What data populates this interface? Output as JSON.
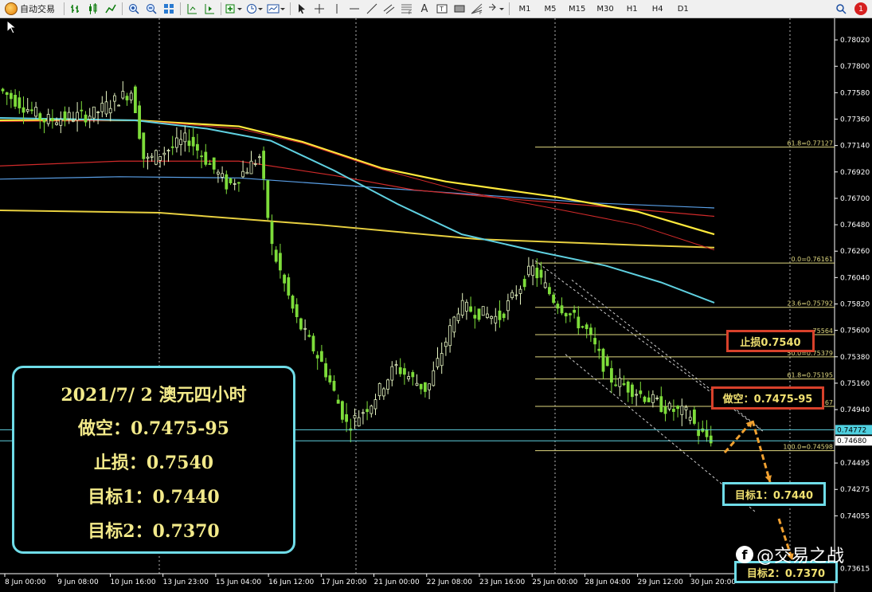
{
  "toolbar": {
    "auto_trade_label": "自动交易",
    "timeframes": [
      "M1",
      "M5",
      "M15",
      "M30",
      "H1",
      "H4",
      "D1"
    ],
    "notification_count": "1"
  },
  "chart_data": {
    "type": "candlestick",
    "symbol_note": "AUDUSD H4",
    "y_ticks": [
      "0.78020",
      "0.77800",
      "0.77580",
      "0.77360",
      "0.77140",
      "0.76920",
      "0.76700",
      "0.76480",
      "0.76260",
      "0.76040",
      "0.75820",
      "0.75600",
      "0.75380",
      "0.75160",
      "0.74940",
      "0.74495",
      "0.74275",
      "0.74055",
      "0.73615"
    ],
    "ylim": [
      0.735,
      0.7812
    ],
    "price_tags": [
      {
        "value": "0.74772",
        "bg": "#4fd0e0"
      },
      {
        "value": "0.74680",
        "bg": "#ffffff"
      }
    ],
    "x_ticks": [
      "8 Jun 00:00",
      "9 Jun 08:00",
      "10 Jun 16:00",
      "13 Jun 23:00",
      "15 Jun 04:00",
      "16 Jun 12:00",
      "17 Jun 20:00",
      "21 Jun 00:00",
      "22 Jun 08:00",
      "23 Jun 16:00",
      "25 Jun 00:00",
      "28 Jun 04:00",
      "29 Jun 12:00",
      "30 Jun 20:00"
    ],
    "fib_levels": [
      {
        "label": "61.8=0.77127",
        "value": 0.77127
      },
      {
        "label": "0.0=0.76161",
        "value": 0.76161
      },
      {
        "label": "23.6=0.75792",
        "value": 0.75792
      },
      {
        "label": "75564",
        "value": 0.75564
      },
      {
        "label": "50.0=0.75379",
        "value": 0.75379
      },
      {
        "label": "61.8=0.75195",
        "value": 0.75195
      },
      {
        "label": "67",
        "value": 0.74967
      },
      {
        "label": "100.0=0.74598",
        "value": 0.74598
      }
    ],
    "horizontal_lines": [
      0.74772,
      0.7468
    ],
    "colors": {
      "bull": "#e6f5c2",
      "bear": "#7ddc3a",
      "ma_cyan": "#5fd0e0",
      "ma_yellow": "#ffea3c",
      "ma_red": "#d02a2a",
      "ma_blue": "#5aa0e8",
      "ma_gold": "#e8d040",
      "fib": "#e0d880",
      "grid": "#ffffff"
    }
  },
  "info_box": {
    "title": "2021/7/ 2 澳元四小时",
    "short": "做空：0.7475-95",
    "stop": "止损：0.7540",
    "target1": "目标1：0.7440",
    "target2": "目标2：0.7370"
  },
  "labels": {
    "stop_loss": "止损0.7540",
    "short_entry": "做空：0.7475-95",
    "target1": "目标1：0.7440",
    "target2": "目标2：0.7370"
  },
  "watermark": "@交易之战"
}
